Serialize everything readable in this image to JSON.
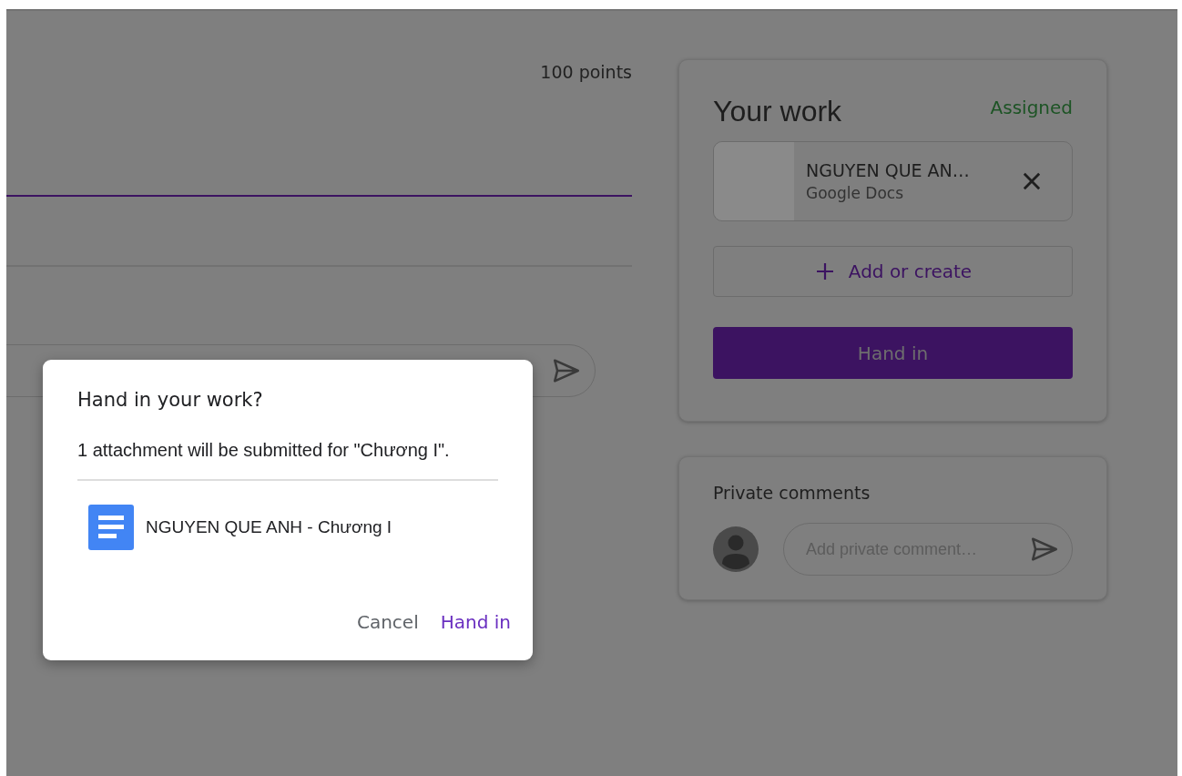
{
  "assignment": {
    "points": "100 points"
  },
  "your_work": {
    "title": "Your work",
    "status": "Assigned",
    "attachments": [
      {
        "name": "NGUYEN QUE AN…",
        "type": "Google Docs"
      }
    ],
    "add_button": "Add or create",
    "hand_in_button": "Hand in"
  },
  "private_comments": {
    "title": "Private comments",
    "placeholder": "Add private comment…"
  },
  "dialog": {
    "title": "Hand in your work?",
    "message": "1 attachment will be submitted for \"Chương I\".",
    "files": [
      {
        "name": "NGUYEN QUE ANH - Chương I"
      }
    ],
    "buttons": [
      {
        "label": "Cancel",
        "kind": "secondary"
      },
      {
        "label": "Hand in",
        "kind": "primary"
      }
    ]
  }
}
